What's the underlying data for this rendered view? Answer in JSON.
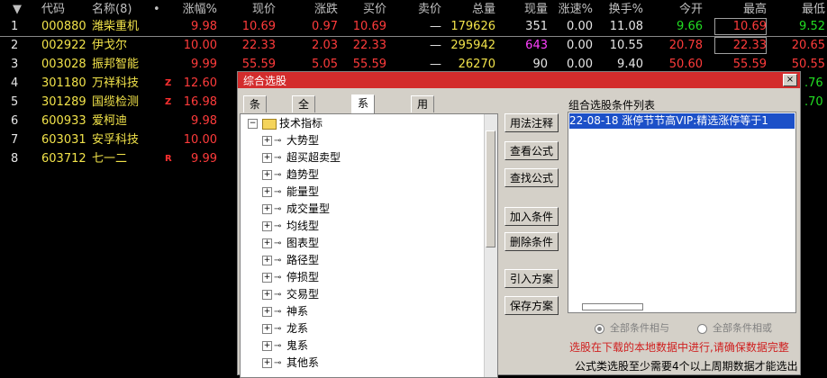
{
  "header": {
    "sort_arrow": "▼",
    "code": "代码",
    "name": "名称(8)",
    "dot": "•",
    "pct": "涨幅%",
    "price": "现价",
    "chg": "涨跌",
    "buy": "买价",
    "sell": "卖价",
    "vol": "总量",
    "cur": "现量",
    "spd": "涨速%",
    "turn": "换手%",
    "open": "今开",
    "high": "最高",
    "low": "最低"
  },
  "rows": [
    {
      "idx": "1",
      "code": "000880",
      "name": "潍柴重机",
      "flag": "",
      "pct": "9.98",
      "price": "10.69",
      "chg": "0.97",
      "buy": "10.69",
      "sell": "—",
      "vol": "179626",
      "cur": "351",
      "spd": "0.00",
      "turn": "11.08",
      "open": "9.66",
      "high": "10.69",
      "low": "9.52"
    },
    {
      "idx": "2",
      "code": "002922",
      "name": "伊戈尔",
      "flag": "",
      "pct": "10.00",
      "price": "22.33",
      "chg": "2.03",
      "buy": "22.33",
      "sell": "—",
      "vol": "295942",
      "cur": "643",
      "spd": "0.00",
      "turn": "10.55",
      "open": "20.78",
      "high": "22.33",
      "low": "20.65"
    },
    {
      "idx": "3",
      "code": "003028",
      "name": "振邦智能",
      "flag": "",
      "pct": "9.99",
      "price": "55.59",
      "chg": "5.05",
      "buy": "55.59",
      "sell": "—",
      "vol": "26270",
      "cur": "90",
      "spd": "0.00",
      "turn": "9.40",
      "open": "50.60",
      "high": "55.59",
      "low": "50.55"
    },
    {
      "idx": "4",
      "code": "301180",
      "name": "万祥科技",
      "flag": "Z",
      "pct": "12.60",
      "low": ".76"
    },
    {
      "idx": "5",
      "code": "301289",
      "name": "国缆检测",
      "flag": "Z",
      "pct": "16.98",
      "low": ".70"
    },
    {
      "idx": "6",
      "code": "600933",
      "name": "爱柯迪",
      "flag": "",
      "pct": "9.98"
    },
    {
      "idx": "7",
      "code": "603031",
      "name": "安孚科技",
      "flag": "",
      "pct": "10.00"
    },
    {
      "idx": "8",
      "code": "603712",
      "name": "七一二",
      "flag": "R",
      "pct": "9.99"
    }
  ],
  "dialog": {
    "title": "综合选股",
    "close": "×",
    "tabs": [
      "条件组",
      "全部条件",
      "系统条件",
      "用户条件"
    ],
    "tree_root": "技术指标",
    "tree_items": [
      "大势型",
      "超买超卖型",
      "趋势型",
      "能量型",
      "成交量型",
      "均线型",
      "图表型",
      "路径型",
      "停损型",
      "交易型",
      "神系",
      "龙系",
      "鬼系",
      "其他系"
    ],
    "buttons": [
      "用法注释",
      "查看公式",
      "查找公式",
      "加入条件",
      "删除条件",
      "引入方案",
      "保存方案"
    ],
    "list_label": "组合选股条件列表",
    "list_items": [
      "22-08-18 涨停节节高VIP:精选涨停等于1"
    ],
    "radio_and": "全部条件相与",
    "radio_or": "全部条件相或",
    "note_red": "选股在下载的本地数据中进行,请确保数据完整",
    "note_black": "公式类选股至少需要4个以上周期数据才能选出"
  }
}
